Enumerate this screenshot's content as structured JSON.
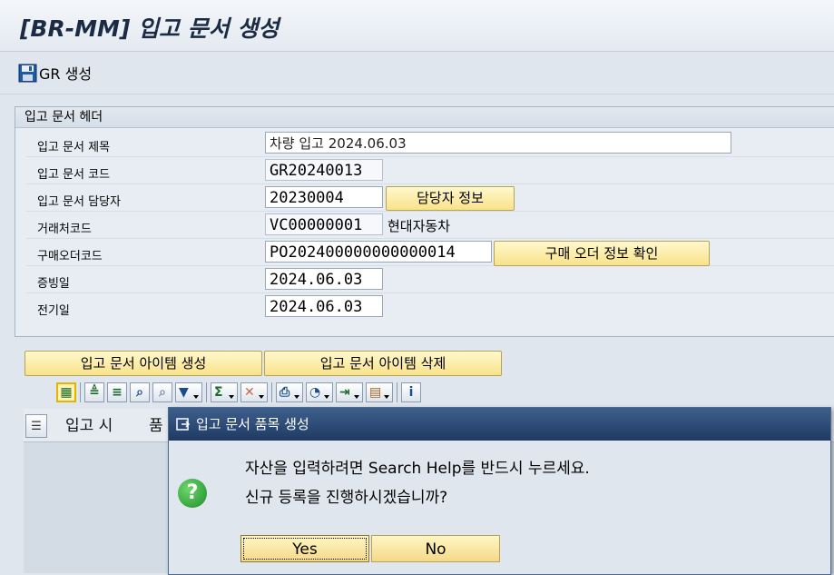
{
  "window": {
    "title": "[BR-MM] 입고 문서 생성"
  },
  "toolbar": {
    "gr_create_label": "GR 생성"
  },
  "header_group": {
    "title": "입고 문서 헤더",
    "fields": {
      "doc_title": {
        "label": "입고 문서 제목",
        "value": "차량 입고 2024.06.03"
      },
      "doc_code": {
        "label": "입고 문서 코드",
        "value": "GR20240013"
      },
      "doc_owner": {
        "label": "입고 문서 담당자",
        "value": "20230004",
        "button": "담당자 정보"
      },
      "vendor_code": {
        "label": "거래처코드",
        "value": "VC00000001",
        "name": "현대자동차"
      },
      "po_code": {
        "label": "구매오더코드",
        "value": "PO202400000000000014",
        "button": "구매 오더 정보 확인"
      },
      "evidence_date": {
        "label": "증빙일",
        "value": "2024.06.03"
      },
      "posting_date": {
        "label": "전기일",
        "value": "2024.06.03"
      }
    }
  },
  "item_actions": {
    "create_label": "입고 문서 아이템 생성",
    "delete_label": "입고 문서 아이템 삭제"
  },
  "grid": {
    "columns": [
      "입고 시",
      "품"
    ]
  },
  "dialog": {
    "title": "입고 문서 품목 생성",
    "line1": "자산을 입력하려면 Search Help를 반드시 누르세요.",
    "line2": "신규 등록을 진행하시겠습니까?",
    "yes_label": "Yes",
    "no_label": "No",
    "icon_glyph": "?"
  },
  "colors": {
    "accent_yellow": "#f8e28a",
    "dialog_title": "#2b4a75",
    "question_green": "#1d8d2b"
  }
}
